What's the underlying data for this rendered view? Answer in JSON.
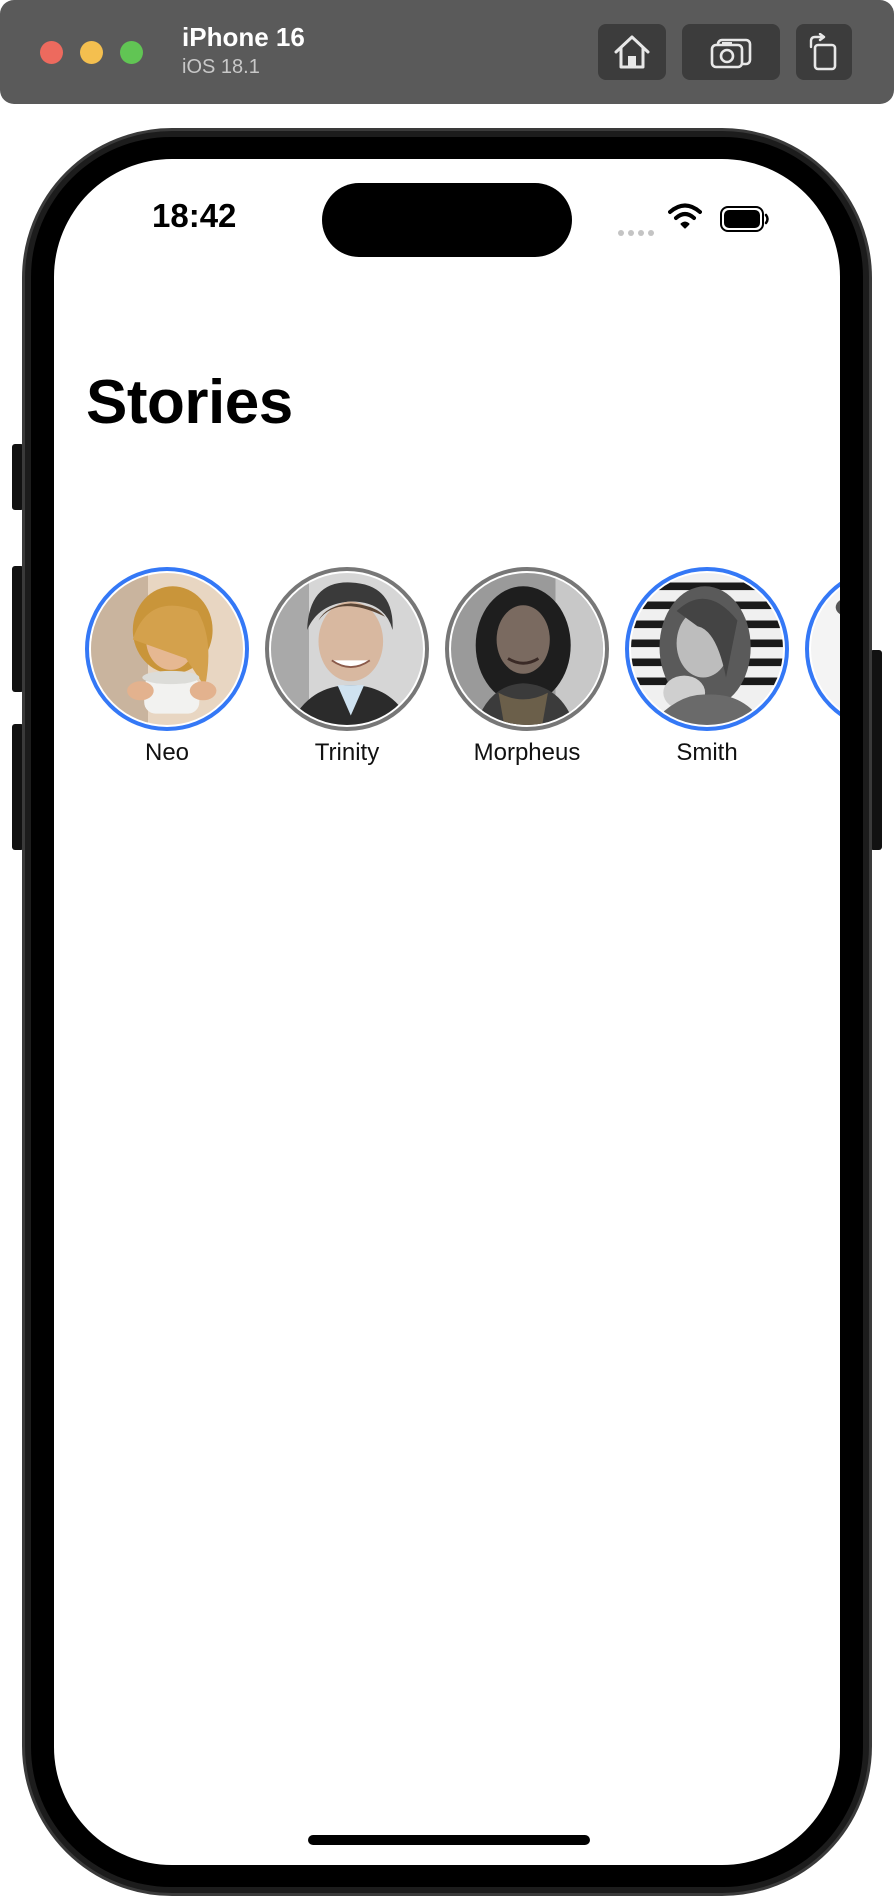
{
  "simulator": {
    "device_name": "iPhone 16",
    "os_version": "iOS 18.1",
    "buttons": [
      {
        "name": "home",
        "icon": "home-icon"
      },
      {
        "name": "screenshot",
        "icon": "camera-icon"
      },
      {
        "name": "rotate",
        "icon": "rotate-icon"
      }
    ]
  },
  "status_bar": {
    "time": "18:42",
    "icons": [
      "cellular-signal-icon",
      "wifi-icon",
      "battery-icon"
    ]
  },
  "page": {
    "title": "Stories"
  },
  "stories": [
    {
      "name": "Neo",
      "unseen": true
    },
    {
      "name": "Trinity",
      "unseen": false
    },
    {
      "name": "Morpheus",
      "unseen": false
    },
    {
      "name": "Smith",
      "unseen": true
    },
    {
      "name": "",
      "unseen": true
    }
  ],
  "colors": {
    "unseen_ring": "#3478f6",
    "seen_ring": "#777777",
    "simulator_bar": "#5a5a5a"
  }
}
